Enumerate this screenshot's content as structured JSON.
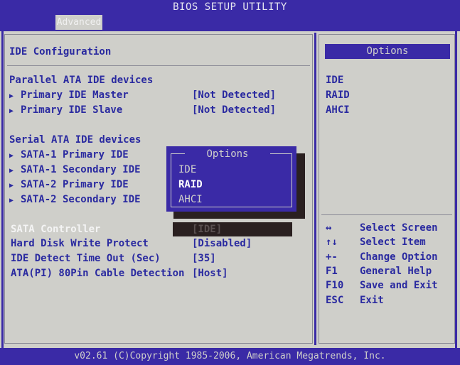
{
  "header": {
    "title": "BIOS SETUP UTILITY",
    "active_tab": "Advanced"
  },
  "left": {
    "section_title": "IDE Configuration",
    "parallel_heading": "Parallel ATA IDE devices",
    "parallel_items": [
      {
        "label": "Primary IDE Master",
        "value": "[Not Detected]"
      },
      {
        "label": "Primary IDE Slave",
        "value": "[Not Detected]"
      }
    ],
    "serial_heading": "Serial ATA IDE devices",
    "serial_items": [
      {
        "label": "SATA-1 Primary IDE"
      },
      {
        "label": "SATA-1 Secondary IDE"
      },
      {
        "label": "SATA-2 Primary IDE"
      },
      {
        "label": "SATA-2 Secondary IDE"
      }
    ],
    "settings": [
      {
        "label": "SATA Controller",
        "value": "[IDE]"
      },
      {
        "label": "Hard Disk Write Protect",
        "value": "[Disabled]"
      },
      {
        "label": "IDE Detect Time Out (Sec)",
        "value": "[35]"
      },
      {
        "label": "ATA(PI) 80Pin Cable Detection",
        "value": "[Host]"
      }
    ]
  },
  "popup": {
    "title": "Options",
    "options": [
      "IDE",
      "RAID",
      "AHCI"
    ],
    "selected": "RAID"
  },
  "right": {
    "options_heading": "Options",
    "options": [
      "IDE",
      "RAID",
      "AHCI"
    ],
    "help": [
      {
        "key": "↔",
        "action": "Select Screen"
      },
      {
        "key": "↑↓",
        "action": "Select Item"
      },
      {
        "key": "+-",
        "action": "Change Option"
      },
      {
        "key": "F1",
        "action": "General Help"
      },
      {
        "key": "F10",
        "action": "Save and Exit"
      },
      {
        "key": "ESC",
        "action": "Exit"
      }
    ]
  },
  "footer": {
    "copyright": "v02.61 (C)Copyright 1985-2006, American Megatrends, Inc."
  },
  "colors": {
    "bios_blue": "#3a2aa6",
    "text_blue": "#2a2aa0",
    "background_gray": "#cfcfca"
  }
}
